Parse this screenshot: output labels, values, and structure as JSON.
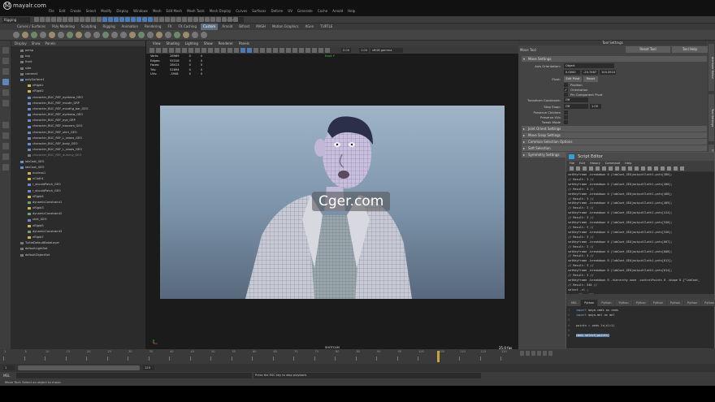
{
  "site": {
    "logo_glyph": "M",
    "name": "mayalr.com",
    "watermark": "Cger.com"
  },
  "menus": [
    "File",
    "Edit",
    "Create",
    "Select",
    "Modify",
    "Display",
    "Windows",
    "Mesh",
    "Edit Mesh",
    "Mesh Tools",
    "Mesh Display",
    "Curves",
    "Surfaces",
    "Deform",
    "UV",
    "Generate",
    "Cache",
    "Arnold",
    "Help"
  ],
  "statusline": {
    "mode": "Rigging",
    "surface_label": "No Live Surface"
  },
  "shelf_tabs": [
    "Curves / Surfaces",
    "Poly Modeling",
    "Sculpting",
    "Rigging",
    "Animation",
    "Rendering",
    "FX",
    "FX Caching",
    "Custom",
    "Arnold",
    "Bifrost",
    "MASH",
    "Motion Graphics",
    "XGen",
    "TURTLE"
  ],
  "shelf_active": "Custom",
  "outliner": {
    "menu": [
      "Display",
      "Show",
      "Panels"
    ],
    "items": [
      {
        "label": "persp",
        "dot": "grey",
        "indent": 1
      },
      {
        "label": "top",
        "dot": "grey",
        "indent": 1
      },
      {
        "label": "front",
        "dot": "grey",
        "indent": 1
      },
      {
        "label": "side",
        "dot": "grey",
        "indent": 1
      },
      {
        "label": "camera1",
        "dot": "grey",
        "indent": 1
      },
      {
        "label": "polySurface1",
        "dot": "blue",
        "indent": 1
      },
      {
        "label": "nRigid1",
        "dot": "yel",
        "indent": 2
      },
      {
        "label": "nRigid2",
        "dot": "yel",
        "indent": 2
      },
      {
        "label": "character_BUC_REF_eyebrow_GEO",
        "dot": "blue",
        "indent": 2
      },
      {
        "label": "character_BUC_REF_mouth_GRP",
        "dot": "blue",
        "indent": 2
      },
      {
        "label": "character_BUC_REF_mouthg_bar_GEO",
        "dot": "blue",
        "indent": 2
      },
      {
        "label": "character_BUC_REF_eyebrow_GEO",
        "dot": "blue",
        "indent": 2
      },
      {
        "label": "character_BUC_REF_eye_GRP",
        "dot": "blue",
        "indent": 2
      },
      {
        "label": "character_BUC_REF_trousers_GEO",
        "dot": "blue",
        "indent": 2
      },
      {
        "label": "character_BUC_REF_shirt_GEO",
        "dot": "blue",
        "indent": 2
      },
      {
        "label": "character_BUC_REF_L_shoes_GEO",
        "dot": "blue",
        "indent": 2
      },
      {
        "label": "character_BUC_REF_body_GEO",
        "dot": "blue",
        "indent": 2
      },
      {
        "label": "character_BUC_REF_L_shoes_GEO",
        "dot": "blue",
        "indent": 2
      },
      {
        "label": "character_BUC_REF_dummy_GEO",
        "dot": "grey",
        "indent": 2,
        "dim": true
      },
      {
        "label": "labCoat_GEO",
        "dot": "blue",
        "indent": 1
      },
      {
        "label": "labCoat_GEO",
        "dot": "blue",
        "indent": 1
      },
      {
        "label": "nucleus1",
        "dot": "yel",
        "indent": 2
      },
      {
        "label": "nCloth1",
        "dot": "yel",
        "indent": 2
      },
      {
        "label": "r_shouldPatch_GEO",
        "dot": "blue",
        "indent": 2
      },
      {
        "label": "r_shouldPatch_GEO",
        "dot": "blue",
        "indent": 2
      },
      {
        "label": "nRigid4",
        "dot": "yel",
        "indent": 2
      },
      {
        "label": "dynamicConstraint1",
        "dot": "green",
        "indent": 2
      },
      {
        "label": "nRigid3",
        "dot": "yel",
        "indent": 2
      },
      {
        "label": "dynamicConstraint2",
        "dot": "green",
        "indent": 2
      },
      {
        "label": "skirt_GEO",
        "dot": "blue",
        "indent": 2
      },
      {
        "label": "nRigid5",
        "dot": "yel",
        "indent": 2
      },
      {
        "label": "dynamicConstraint3",
        "dot": "green",
        "indent": 2
      },
      {
        "label": "nRigid7",
        "dot": "yel",
        "indent": 2
      },
      {
        "label": "TurtleDefaultBakeLayer",
        "dot": "grey",
        "indent": 1
      },
      {
        "label": "defaultLightSet",
        "dot": "grey",
        "indent": 1
      },
      {
        "label": "defaultObjectSet",
        "dot": "grey",
        "indent": 1
      }
    ]
  },
  "viewport": {
    "menu": [
      "View",
      "Shading",
      "Lighting",
      "Show",
      "Renderer",
      "Panels"
    ],
    "colorspace": "sRGB gamma",
    "exposure": "0.00",
    "gamma": "1.00",
    "top_label": "front Y",
    "hud": [
      {
        "label": "Verts:",
        "v1": "26969",
        "v2": "0",
        "v3": "0"
      },
      {
        "label": "Edges:",
        "v1": "55316",
        "v2": "0",
        "v3": "0"
      },
      {
        "label": "Faces:",
        "v1": "28413",
        "v2": "0",
        "v3": "0"
      },
      {
        "label": "Tris:",
        "v1": "52894",
        "v2": "0",
        "v3": "0"
      },
      {
        "label": "UVs:",
        "v1": "-3948",
        "v2": "0",
        "v3": "0"
      }
    ],
    "camera_label": "SHOTCAM",
    "fps": "25.0 fps"
  },
  "tool_settings": {
    "header": "Tool Settings",
    "title": "Move Tool",
    "reset_label": "Reset Tool",
    "help_label": "Tool Help",
    "sections_open": "Move Settings",
    "axis_label": "Axis Orientation:",
    "axis_value": "Object",
    "xyz": [
      "0.0000",
      "-20.7487",
      "104.3510"
    ],
    "pivot_label": "Pivot:",
    "edit_pivot": "Edit Pivot",
    "reset_pivot": "Reset",
    "pivot_checks": [
      {
        "label": "Position",
        "checked": false
      },
      {
        "label": "Orientation",
        "checked": true
      },
      {
        "label": "Pin Component Pivot",
        "checked": false
      }
    ],
    "transform_constraint_label": "Transform Constraint:",
    "transform_constraint_value": "Off",
    "step_snap_label": "Step Snap:",
    "step_snap_value": "Off",
    "step_snap_num": "1.00",
    "checks2": [
      "Preserve Children",
      "Preserve UVs",
      "Tweak Mode"
    ],
    "collapsed_sections": [
      "Joint Orient Settings",
      "Move Snap Settings",
      "Common Selection Options",
      "Soft Selection",
      "Symmetry Settings"
    ]
  },
  "side_tabs": [
    "Attribute Editor",
    "Tool Settings",
    "Channel Box / Layer Editor",
    "Modeling Toolkit"
  ],
  "script_editor": {
    "title": "Script Editor",
    "menu": [
      "File",
      "Edit",
      "History",
      "Command",
      "Help"
    ],
    "history": [
      "setKeyframe -breakdown 0 |labCoat_GEO|outputCloth1.pnts[380];",
      "// Result: 3 //",
      "setKeyframe -breakdown 0 |labCoat_GEO|outputCloth1.pnts[400];",
      "// Result: 3 //",
      "setKeyframe -breakdown 0 |labCoat_GEO|outputCloth1.pnts[408];",
      "// Result: 3 //",
      "setKeyframe -breakdown 0 |labCoat_GEO|outputCloth1.pnts[409];",
      "// Result: 3 //",
      "setKeyframe -breakdown 0 |labCoat_GEO|outputCloth1.pnts[414];",
      "// Result: 3 //",
      "setKeyframe -breakdown 0 |labCoat_GEO|outputCloth1.pnts[530];",
      "// Result: 3 //",
      "setKeyframe -breakdown 0 |labCoat_GEO|outputCloth1.pnts[536];",
      "// Result: 3 //",
      "setKeyframe -breakdown 0 |labCoat_GEO|outputCloth1.pnts[607];",
      "// Result: 3 //",
      "setKeyframe -breakdown 0 |labCoat_GEO|outputCloth1.pnts[608];",
      "// Result: 3 //",
      "setKeyframe -breakdown 0 |labCoat_GEO|outputCloth1.pnts[613];",
      "// Result: 3 //",
      "setKeyframe -breakdown 0 |labCoat_GEO|outputCloth1.pnts[614];",
      "// Result: 3 //",
      "setKeyframe -breakdown 0 -hierarchy none -controlPoints 0 -shape 0 {\"labCoat_",
      "// Result: 546 //",
      "select -cl ;",
      "currentTime 105 ;",
      "// Press the ESC key to stop playback. //"
    ],
    "tabs": [
      "MEL",
      "Python",
      "Python",
      "Python",
      "Python",
      "Python",
      "Python",
      "Python",
      "Python",
      "Python"
    ],
    "input": [
      {
        "a": "import",
        "b": " maya.cmds as cmds"
      },
      {
        "a": "import",
        "b": " maya.mel as mel"
      },
      {
        "a": "",
        "b": ""
      },
      {
        "a": "",
        "b": "points = cmds.ls(sl=1)"
      },
      {
        "a": "",
        "b": ""
      },
      {
        "a": "",
        "b": "cmds.select(points)"
      }
    ]
  },
  "timeline": {
    "ticks": [
      "1",
      "5",
      "10",
      "15",
      "20",
      "25",
      "30",
      "35",
      "40",
      "45",
      "50",
      "55",
      "60",
      "65",
      "70",
      "75",
      "80",
      "85",
      "90",
      "95",
      "100",
      "105",
      "110",
      "115",
      "120"
    ],
    "range_start": "1",
    "range_end": "120"
  },
  "cmdline": {
    "lang": "MEL",
    "message": "Press the ESC key to stop playback."
  },
  "helpline": "Move Tool: Select an object to move."
}
